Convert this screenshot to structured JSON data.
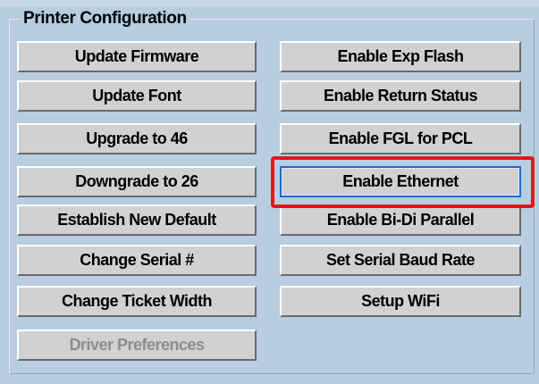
{
  "group": {
    "title": "Printer Configuration"
  },
  "buttons": {
    "update_firmware": "Update Firmware",
    "update_font": "Update Font",
    "upgrade_to_46": "Upgrade to 46",
    "downgrade_to_26": "Downgrade to 26",
    "establish_new_default": "Establish New Default",
    "change_serial": "Change Serial #",
    "change_ticket_width": "Change Ticket Width",
    "driver_preferences": "Driver Preferences",
    "enable_exp_flash": "Enable Exp Flash",
    "enable_return_status": "Enable Return Status",
    "enable_fgl_for_pcl": "Enable FGL for PCL",
    "enable_ethernet": "Enable Ethernet",
    "enable_bidi_parallel": "Enable Bi-Di Parallel",
    "set_serial_baud_rate": "Set Serial Baud Rate",
    "setup_wifi": "Setup WiFi"
  },
  "colors": {
    "background": "#b8cde0",
    "button_face": "#d1d1d1",
    "focus_border": "#1e6ad6",
    "highlight": "#e8151c",
    "disabled_text": "#8c8c8c"
  }
}
